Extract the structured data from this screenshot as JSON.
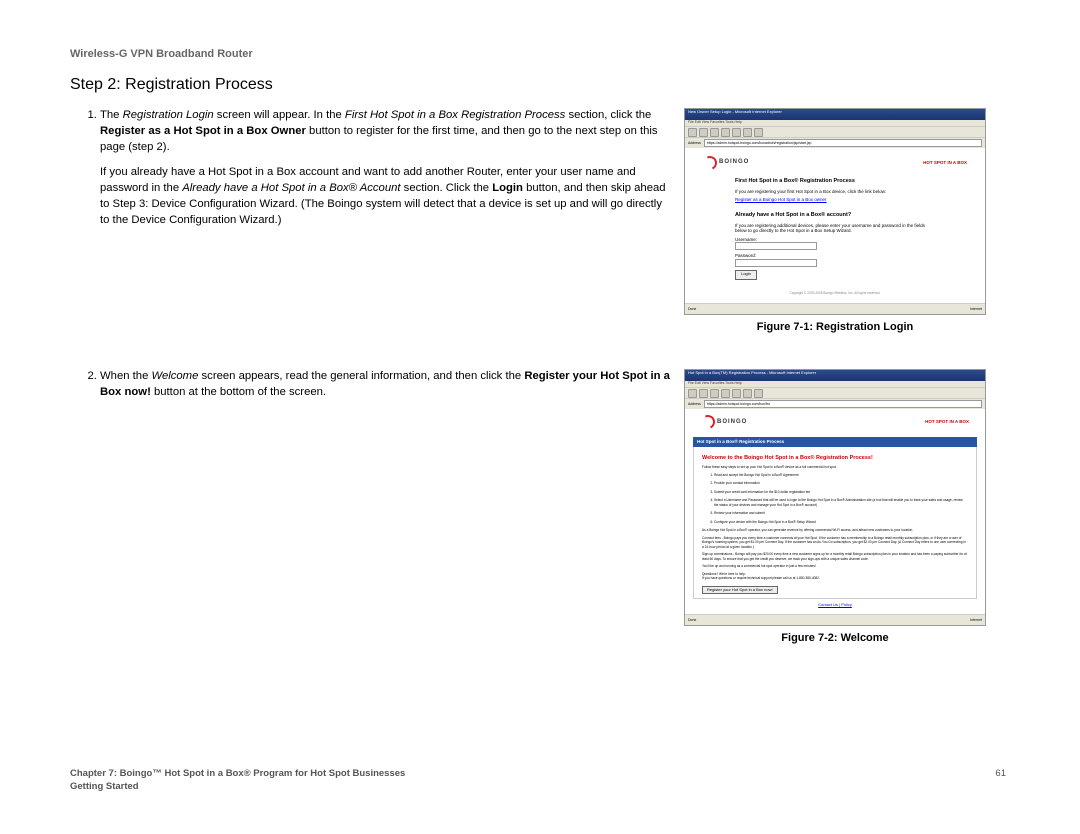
{
  "header": {
    "product": "Wireless-G VPN Broadband Router"
  },
  "step_title": "Step 2: Registration Process",
  "item1": {
    "pre": "The ",
    "em1": "Registration Login",
    "mid1": " screen will appear. In the ",
    "em2": "First Hot Spot in a Box Registration Process",
    "mid2": " section, click the ",
    "b1": "Register as a Hot Spot in a Box Owner",
    "post": " button to register for the first time, and then go to the next step on this page (step 2)."
  },
  "para1": {
    "pre": "If you already have a Hot Spot in a Box account and want to add another Router, enter your user name and password in the ",
    "em1": "Already have a Hot Spot in a Box® Account",
    "mid1": " section. Click the ",
    "b1": "Login",
    "post": " button, and then skip ahead to Step 3: Device Configuration Wizard. (The Boingo system will detect that a device is set up and will go directly to the Device Configuration Wizard.)"
  },
  "item2": {
    "pre": "When the ",
    "em1": "Welcome",
    "mid1": " screen appears, read the general information, and then click the ",
    "b1": "Register your Hot Spot in a Box now!",
    "post": " button at the bottom of the screen."
  },
  "fig1": {
    "caption": "Figure 7-1: Registration Login",
    "title": "New Owner Setup Login - Microsoft Internet Explorer",
    "menu": "File   Edit   View   Favorites   Tools   Help",
    "addr_label": "Address",
    "addr_url": "https://admin.hotspot.boingo.com/boxadmin/registration/jsp/start.jsp",
    "brand": "BOINGO",
    "brand2": "HOT SPOT\nIN A BOX",
    "hd1": "First Hot Spot in a Box® Registration Process",
    "t1": "If you are registering your first Hot Spot in a Box device, click the link below:",
    "link1": "Register as a Boingo Hot Spot in a Box owner",
    "hd2": "Already have a Hot Spot in a Box® account?",
    "t2": "If you are registering additional devices, please enter your username and password in the fields below to go directly to the Hot Spot in a Box Setup Wizard.",
    "lbl_user": "Username:",
    "lbl_pass": "Password:",
    "btn_login": "Login",
    "copyright": "Copyright © 2003-2005 Boingo Wireless, Inc. All rights reserved.",
    "foot_right": "Internet",
    "foot_left": "Done"
  },
  "fig2": {
    "caption": "Figure 7-2: Welcome",
    "title": "Hot Spot in a Box(TM) Registration Process - Microsoft Internet Explorer",
    "menu": "File   Edit   View   Favorites   Tools   Help",
    "addr_label": "Address",
    "addr_url": "https://admin.hotspot.boingo.com/box/fst",
    "brand": "BOINGO",
    "brand2": "HOT SPOT\nIN A BOX",
    "bluebar": "Hot Spot in a Box® Registration Process",
    "hd1": "Welcome to the Boingo Hot Spot in a Box® Registration Process!",
    "t1": "Follow these easy steps to set up your Hot Spot in a Box® device as a full commercial hot spot:",
    "steps": [
      "Read and accept the Boingo Hot Spot in a Box® Agreement",
      "Provide your contact information",
      "Submit your credit card information for the $10 dollar registration fee",
      "Select a Username and Password that will be used to login to the Boingo Hot Spot in a Box® Administration site (a tool that will enable you to track your sales and usage, review the status of your devices and manage your Hot Spot in a Box® account)",
      "Review your information and submit",
      "Configure your device with the Boingo Hot Spot in a Box® Setup Wizard"
    ],
    "t2": "As a Boingo Hot Spot in a Box® operator, you can generate revenue by offering commercial Wi-Fi access, and attract new customers to your location.",
    "t3": "Connect fees - Boingo pays you every time a customer connects at your Hot Spot. If the customer has a membership to a Boingo retail monthly subscription plan, or if they are a user of Boingo's roaming system, you get $1.00 per Connect Day. If the customer has an As-You-Go subscription, you get $2.00 per Connect Day. (A Connect Day refers to one user connecting in a 24-hour period at a given location.)",
    "t4": "Sign-up commissions - Boingo will pay you $20.00 every time a new customer signs up for a monthly retail Boingo subscription plan in your location and has been a paying subscriber for at least 60 days. To ensure that you get the credit you deserve, we track your sign-ups with a unique sales channel code.",
    "t5": "You'll be up and running as a commercial hot spot operator in just a few minutes!",
    "t6": "Questions? We're here to help.\nIf you have questions or require technical support please call us at 1-800-380-4082.",
    "btn_reg": "Register your Hot Spot in a Box now!",
    "foot_link": "Contact Us | Policy",
    "foot_left": "Done",
    "foot_right": "Internet"
  },
  "footer": {
    "chapter": "Chapter 7: Boingo™ Hot Spot in a Box® Program for Hot Spot Businesses",
    "section": "Getting Started",
    "page": "61"
  }
}
